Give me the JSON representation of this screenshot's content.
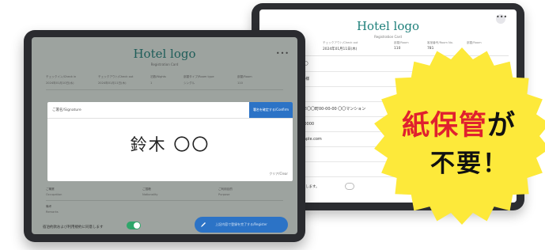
{
  "back_tablet": {
    "logo": "Hotel logo",
    "subtitle": "Registration Card",
    "menu_glyph": "•••",
    "header": [
      {
        "label": "チェックアウト/Check out",
        "value": "2024年01月11日(木)"
      },
      {
        "label": "部屋/Room",
        "value": "110"
      },
      {
        "label": "客室番号/Room No.",
        "value": "781"
      },
      {
        "label": "部屋/Room",
        "value": ""
      }
    ],
    "rows": [
      "鈴木 〇〇",
      "木 〇〇 様",
      "0-0000",
      "都〇〇市〇〇町00-00-00 〇〇マンション",
      "-0000-0000",
      "@example.com",
      "員",
      ""
    ],
    "footer_text": "約を受領します。"
  },
  "front_tablet": {
    "logo": "Hotel logo",
    "subtitle": "Registration Card",
    "menu_glyph": "•••",
    "header_labels": [
      "チェックイン/Check in",
      "チェックアウト/Check out",
      "泊数/Nights",
      "部屋タイプ/Room type",
      "部屋/Room"
    ],
    "header_values": [
      "2024年01月10日(水)",
      "2024年01月11日(木)",
      "1",
      "シングル",
      "110"
    ],
    "signature_dialog": {
      "label": "ご署名/Signature",
      "confirm_button": "署名を確定する/Confirm",
      "signature_text": "鈴木 〇〇",
      "clear_label": "クリア/Clear"
    },
    "form_fields": [
      {
        "label": "ご職業",
        "value": "Occupation"
      },
      {
        "label": "ご国籍",
        "value": "Nationality"
      },
      {
        "label": "ご利用目的",
        "value": "Purpose"
      },
      {
        "label": "備考",
        "value": "Remarks"
      }
    ],
    "consent_text": "宿泊約款および利用規約に同意します",
    "consent_toggle_on": true,
    "submit_button": "上記内容で登録を完了する/Register"
  },
  "badge": {
    "line1_red": "紙保管",
    "line1_black": "が",
    "line2": "不要！",
    "color_fill": "#fde93a",
    "color_red": "#e0202e"
  }
}
